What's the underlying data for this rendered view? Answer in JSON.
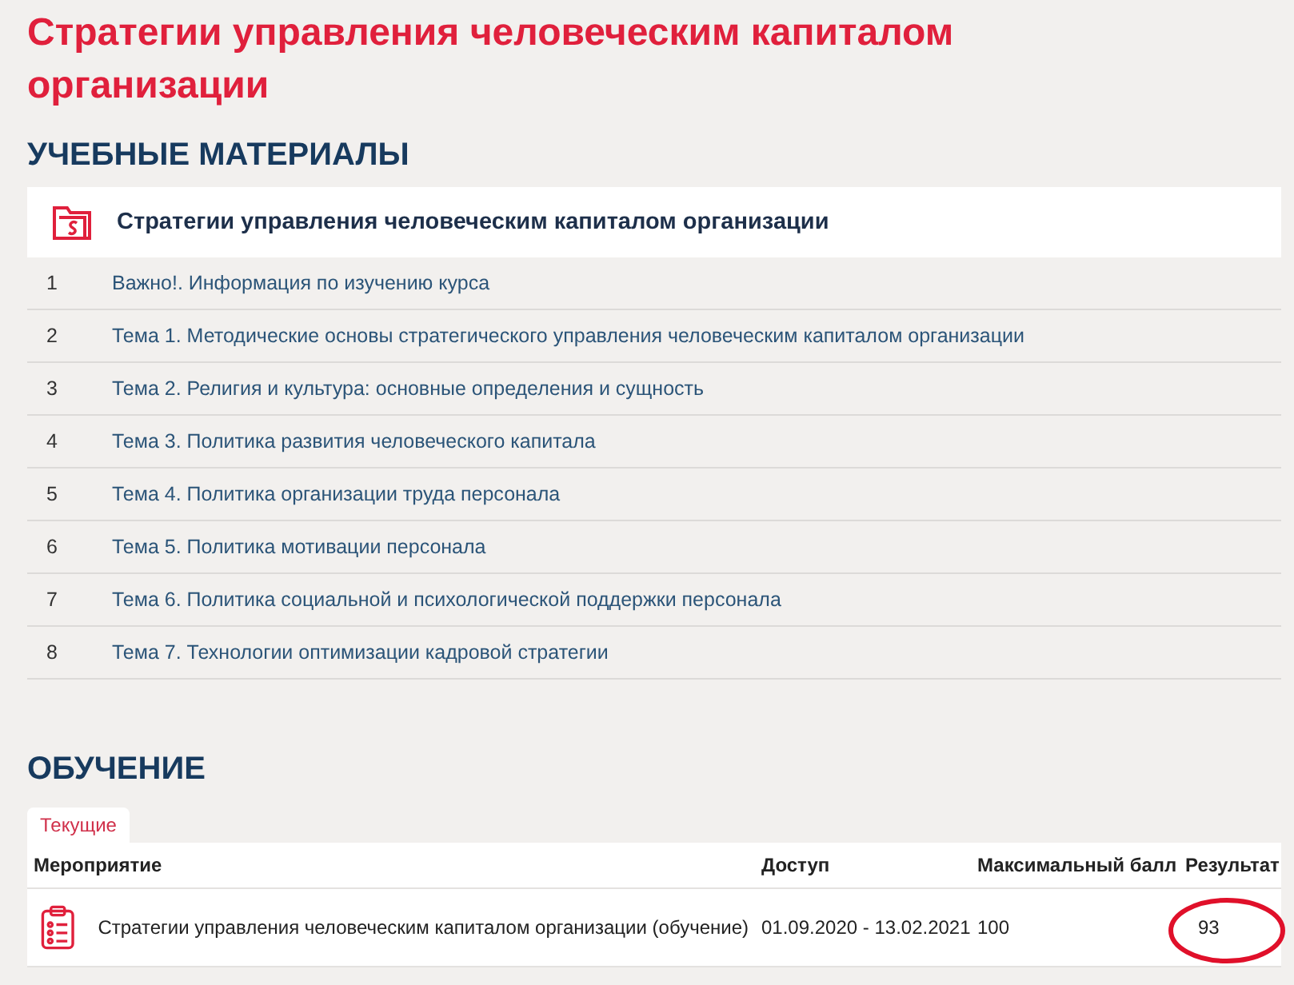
{
  "page_title": "Стратегии управления человеческим капиталом организации",
  "materials": {
    "heading": "УЧЕБНЫЕ МАТЕРИАЛЫ",
    "course_title": "Стратегии управления человеческим капиталом организации",
    "items": [
      {
        "number": "1",
        "title": "Важно!. Информация по изучению курса"
      },
      {
        "number": "2",
        "title": "Тема 1. Методические основы стратегического управления человеческим капиталом организации"
      },
      {
        "number": "3",
        "title": "Тема 2. Религия и культура: основные определения и сущность"
      },
      {
        "number": "4",
        "title": "Тема 3. Политика развития человеческого капитала"
      },
      {
        "number": "5",
        "title": "Тема 4. Политика организации труда персонала"
      },
      {
        "number": "6",
        "title": "Тема 5. Политика мотивации персонала"
      },
      {
        "number": "7",
        "title": "Тема 6. Политика социальной и психологической поддержки персонала"
      },
      {
        "number": "8",
        "title": "Тема 7. Технологии оптимизации кадровой стратегии"
      }
    ]
  },
  "learning": {
    "heading": "ОБУЧЕНИЕ",
    "tabs": [
      {
        "label": "Текущие",
        "selected": true
      }
    ],
    "table": {
      "columns": [
        "Мероприятие",
        "Доступ",
        "Максимальный балл",
        "Результат"
      ],
      "rows": [
        {
          "event": "Стратегии управления человеческим капиталом организации (обучение)",
          "access": "01.09.2020 - 13.02.2021",
          "max_score": "100",
          "result": "93",
          "result_circled": true
        }
      ]
    }
  }
}
